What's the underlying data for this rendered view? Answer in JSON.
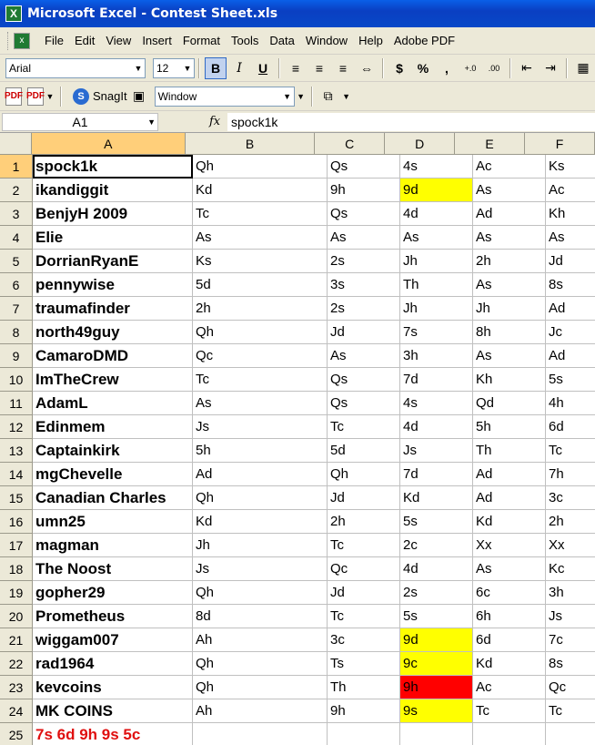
{
  "window": {
    "title": "Microsoft Excel - Contest Sheet.xls",
    "app_icon": "excel-icon"
  },
  "menu": [
    "File",
    "Edit",
    "View",
    "Insert",
    "Format",
    "Tools",
    "Data",
    "Window",
    "Help",
    "Adobe PDF"
  ],
  "format_toolbar": {
    "font": "Arial",
    "size": "12",
    "bold": "B",
    "italic": "I",
    "underline": "U",
    "currency": "$",
    "percent": "%",
    "comma": ",",
    "inc_decimal": "+.0",
    "dec_decimal": ".00"
  },
  "toolbar3": {
    "snagit": "SnagIt",
    "window_combo": "Window"
  },
  "formula_bar": {
    "name_box": "A1",
    "fx": "fx",
    "content": "spock1k"
  },
  "columns": [
    "A",
    "B",
    "C",
    "D",
    "E",
    "F"
  ],
  "rows": [
    {
      "n": "1",
      "cells": [
        "spock1k",
        "Qh",
        "Qs",
        "4s",
        "Ac",
        "Ks"
      ]
    },
    {
      "n": "2",
      "cells": [
        "ikandiggit",
        "Kd",
        "9h",
        "9d",
        "As",
        "Ac"
      ]
    },
    {
      "n": "3",
      "cells": [
        "BenjyH 2009",
        "Tc",
        "Qs",
        "4d",
        "Ad",
        "Kh"
      ]
    },
    {
      "n": "4",
      "cells": [
        "Elie",
        "As",
        "As",
        "As",
        "As",
        "As"
      ]
    },
    {
      "n": "5",
      "cells": [
        "DorrianRyanE",
        "Ks",
        "2s",
        "Jh",
        "2h",
        "Jd"
      ]
    },
    {
      "n": "6",
      "cells": [
        "pennywise",
        "5d",
        "3s",
        "Th",
        "As",
        "8s"
      ]
    },
    {
      "n": "7",
      "cells": [
        "traumafinder",
        "2h",
        "2s",
        "Jh",
        "Jh",
        "Ad"
      ]
    },
    {
      "n": "8",
      "cells": [
        "north49guy",
        "Qh",
        "Jd",
        "7s",
        "8h",
        "Jc"
      ]
    },
    {
      "n": "9",
      "cells": [
        "CamaroDMD",
        "Qc",
        "As",
        "3h",
        "As",
        "Ad"
      ]
    },
    {
      "n": "10",
      "cells": [
        "ImTheCrew",
        "Tc",
        "Qs",
        "7d",
        "Kh",
        "5s"
      ]
    },
    {
      "n": "11",
      "cells": [
        "AdamL",
        "As",
        "Qs",
        "4s",
        "Qd",
        "4h"
      ]
    },
    {
      "n": "12",
      "cells": [
        "Edinmem",
        "Js",
        "Tc",
        "4d",
        "5h",
        "6d"
      ]
    },
    {
      "n": "13",
      "cells": [
        "Captainkirk",
        "5h",
        "5d",
        "Js",
        "Th",
        "Tc"
      ]
    },
    {
      "n": "14",
      "cells": [
        "mgChevelle",
        "Ad",
        "Qh",
        "7d",
        "Ad",
        "7h"
      ]
    },
    {
      "n": "15",
      "cells": [
        "Canadian Charles",
        "Qh",
        "Jd",
        "Kd",
        "Ad",
        "3c"
      ]
    },
    {
      "n": "16",
      "cells": [
        "umn25",
        "Kd",
        "2h",
        "5s",
        "Kd",
        "2h"
      ]
    },
    {
      "n": "17",
      "cells": [
        "magman",
        "Jh",
        "Tc",
        "2c",
        "Xx",
        "Xx"
      ]
    },
    {
      "n": "18",
      "cells": [
        "The Noost",
        "Js",
        "Qc",
        "4d",
        "As",
        "Kc"
      ]
    },
    {
      "n": "19",
      "cells": [
        "gopher29",
        "Qh",
        "Jd",
        "2s",
        "6c",
        "3h"
      ]
    },
    {
      "n": "20",
      "cells": [
        "Prometheus",
        "8d",
        "Tc",
        "5s",
        "6h",
        "Js"
      ]
    },
    {
      "n": "21",
      "cells": [
        "wiggam007",
        "Ah",
        "3c",
        "9d",
        "6d",
        "7c"
      ]
    },
    {
      "n": "22",
      "cells": [
        "rad1964",
        "Qh",
        "Ts",
        "9c",
        "Kd",
        "8s"
      ]
    },
    {
      "n": "23",
      "cells": [
        "kevcoins",
        "Qh",
        "Th",
        "9h",
        "Ac",
        "Qc"
      ]
    },
    {
      "n": "24",
      "cells": [
        "MK COINS",
        "Ah",
        "9h",
        "9s",
        "Tc",
        "Tc"
      ]
    },
    {
      "n": "25",
      "cells": [
        "7s 6d 9h 9s 5c",
        "",
        "",
        "",
        "",
        ""
      ]
    }
  ],
  "highlights": {
    "yellow": "#ffff00",
    "red": "#ff0000",
    "red_text": "#e01010"
  }
}
